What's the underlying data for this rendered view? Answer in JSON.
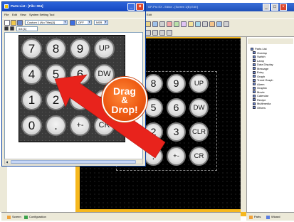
{
  "main_window": {
    "title": "GP-Pro EX - Editor - [Screen 1(B) Edit ]",
    "menu": "Edit"
  },
  "parts_window": {
    "title": "Parts List - [File: 004]",
    "menu": [
      "File",
      "Edit",
      "View",
      "System Setting",
      "Tool"
    ],
    "combo_style": "Custom 1 (No Title)[4]",
    "combo_state": "OFF",
    "combo_state2": "NSR",
    "combo_id": "0/4 [1]"
  },
  "keypad_large": {
    "rows": [
      [
        "7",
        "8",
        "9",
        "UP"
      ],
      [
        "4",
        "5",
        "6",
        "DW"
      ],
      [
        "1",
        "2",
        "3",
        "CLR"
      ],
      [
        "0",
        ".",
        "+-",
        "CR"
      ]
    ]
  },
  "keypad_small": {
    "rows": [
      [
        "7",
        "8",
        "9",
        "UP"
      ],
      [
        "4",
        "5",
        "6",
        "DW"
      ],
      [
        "1",
        "2",
        "3",
        "CLR"
      ],
      [
        "0",
        ".",
        "+-",
        "CR"
      ]
    ]
  },
  "badge": {
    "line1": "Drag",
    "line2": "&",
    "line3": "Drop!"
  },
  "parts_tree": [
    "Parts List",
    "Overlap",
    "Switch",
    "Lamp",
    "Data Display",
    "Message",
    "Entry",
    "Graph",
    "Trend Graph",
    "Alarm",
    "Graphic",
    "Movie",
    "Calendar",
    "Recipe",
    "Multimedia",
    "Others"
  ],
  "bottom_tabs": {
    "screen": "Screen",
    "configuration": "Configuration"
  },
  "pane_tabs": {
    "parts": "Parts",
    "wizard": "Wizard"
  },
  "colors": {
    "accent_orange": "#ee5a12",
    "arrow_red": "#e8231c",
    "canvas_orange": "#f6b81e",
    "titlebar_blue": "#1447c0"
  }
}
